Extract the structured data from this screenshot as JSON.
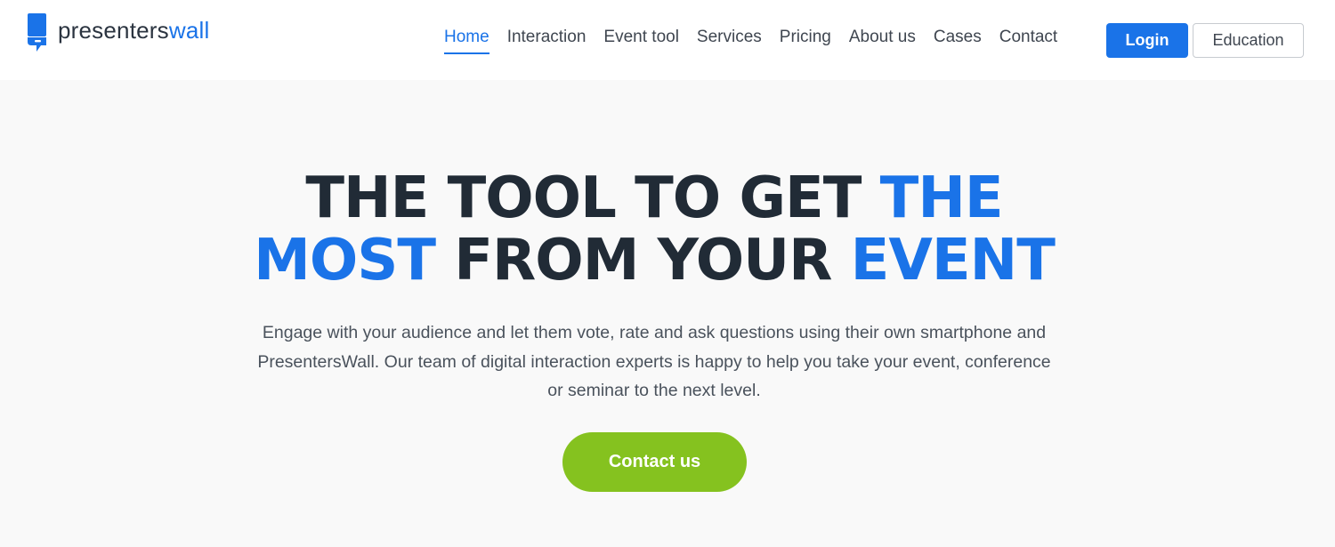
{
  "brand": {
    "name_part1": "presenters",
    "name_part2": "wall",
    "icon": "speech-bubble-logo-icon",
    "color_primary": "#1a73e8",
    "color_text": "#2b3440"
  },
  "nav": {
    "items": [
      {
        "label": "Home",
        "active": true
      },
      {
        "label": "Interaction",
        "active": false
      },
      {
        "label": "Event tool",
        "active": false
      },
      {
        "label": "Services",
        "active": false
      },
      {
        "label": "Pricing",
        "active": false
      },
      {
        "label": "About us",
        "active": false
      },
      {
        "label": "Cases",
        "active": false
      },
      {
        "label": "Contact",
        "active": false
      }
    ],
    "login_label": "Login",
    "education_label": "Education"
  },
  "hero": {
    "headline": {
      "line1_dark": "THE TOOL TO GET ",
      "line1_blue": "THE",
      "line2_blue1": "MOST",
      "line2_dark": " FROM YOUR ",
      "line2_blue2": "EVENT"
    },
    "subtext": "Engage with your audience and let them vote, rate and ask questions using their own smartphone and PresentersWall. Our team of digital interaction experts is happy to help you take your event, conference or seminar to the next level.",
    "cta_label": "Contact us",
    "cta_color": "#85c21f"
  }
}
